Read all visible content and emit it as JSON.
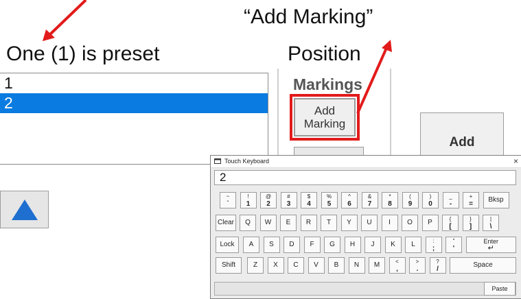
{
  "annotations": {
    "add_marking_quote": "“Add Marking”",
    "one_preset": "One (1) is preset",
    "position": "Position"
  },
  "list": {
    "items": [
      "1",
      "2"
    ],
    "selected_index": 1
  },
  "markings_panel": {
    "title": "Markings",
    "add_marking_line1": "Add",
    "add_marking_line2": "Marking",
    "add_button": "Add"
  },
  "keyboard": {
    "title": "Touch Keyboard",
    "close": "×",
    "input_value": "2",
    "paste": "Paste",
    "row1": [
      {
        "s": "~",
        "b": "`"
      },
      {
        "s": "!",
        "b": "1"
      },
      {
        "s": "@",
        "b": "2"
      },
      {
        "s": "#",
        "b": "3"
      },
      {
        "s": "$",
        "b": "4"
      },
      {
        "s": "%",
        "b": "5"
      },
      {
        "s": "^",
        "b": "6"
      },
      {
        "s": "&",
        "b": "7"
      },
      {
        "s": "*",
        "b": "8"
      },
      {
        "s": "(",
        "b": "9"
      },
      {
        "s": ")",
        "b": "0"
      },
      {
        "s": "_",
        "b": "-"
      },
      {
        "s": "+",
        "b": "="
      }
    ],
    "bksp": "Bksp",
    "clear": "Clear",
    "row2": [
      "Q",
      "W",
      "E",
      "R",
      "T",
      "Y",
      "U",
      "I",
      "O",
      "P"
    ],
    "row2_extra": [
      {
        "s": "{",
        "b": "["
      },
      {
        "s": "}",
        "b": "]"
      },
      {
        "s": "|",
        "b": "\\"
      }
    ],
    "lock": "Lock",
    "row3": [
      "A",
      "S",
      "D",
      "F",
      "G",
      "H",
      "J",
      "K",
      "L"
    ],
    "row3_extra": [
      {
        "s": ":",
        "b": ";"
      },
      {
        "s": "\"",
        "b": "'"
      }
    ],
    "enter": "Enter",
    "shift": "Shift",
    "row4": [
      "Z",
      "X",
      "C",
      "V",
      "B",
      "N",
      "M"
    ],
    "row4_extra": [
      {
        "s": "<",
        "b": ","
      },
      {
        "s": ">",
        "b": "."
      },
      {
        "s": "?",
        "b": "/"
      }
    ],
    "space": "Space"
  },
  "colors": {
    "selection": "#0a7be0",
    "annotation_red": "#e21b1b",
    "up_arrow": "#1f6fd0"
  },
  "icons": {
    "up": "up-arrow-icon",
    "keyboard": "keyboard-icon",
    "close": "close-icon"
  }
}
